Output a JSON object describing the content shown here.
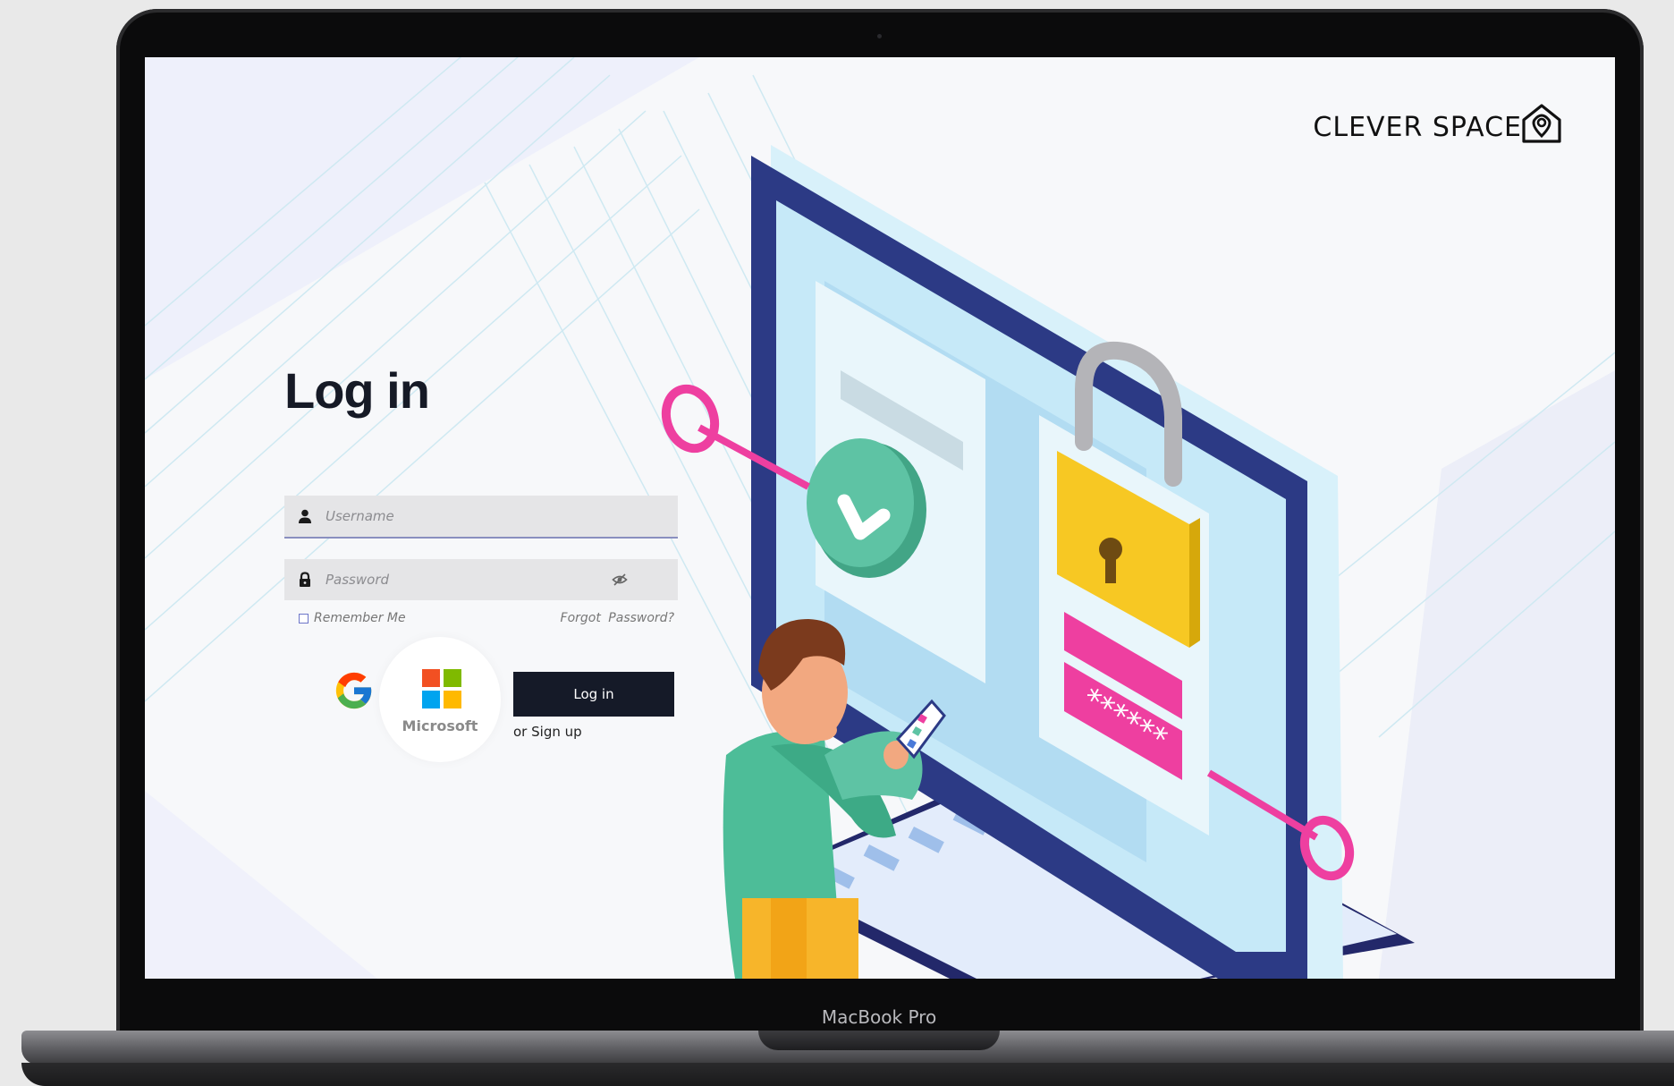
{
  "brand": {
    "name": "CLEVER SPACE",
    "icon": "house-pin-icon"
  },
  "login": {
    "title": "Log in",
    "username_placeholder": "Username",
    "password_placeholder": "Password",
    "remember_me": "Remember Me",
    "forgot_password": "Forgot Password?",
    "submit_label": "Log in",
    "signup_prefix": "or",
    "signup_link": "Sign up"
  },
  "social": {
    "google_icon": "google-g-icon",
    "microsoft_label": "Microsoft"
  },
  "device": {
    "model": "MacBook Pro"
  },
  "illustration": {
    "password_mask": "******"
  },
  "colors": {
    "dark_button": "#151a28",
    "field_bg": "#e5e5e7",
    "accent_pink": "#ee3fa0",
    "lock_yellow": "#f7c823",
    "monitor_navy": "#2c3a85",
    "check_green": "#5ec3a4"
  }
}
